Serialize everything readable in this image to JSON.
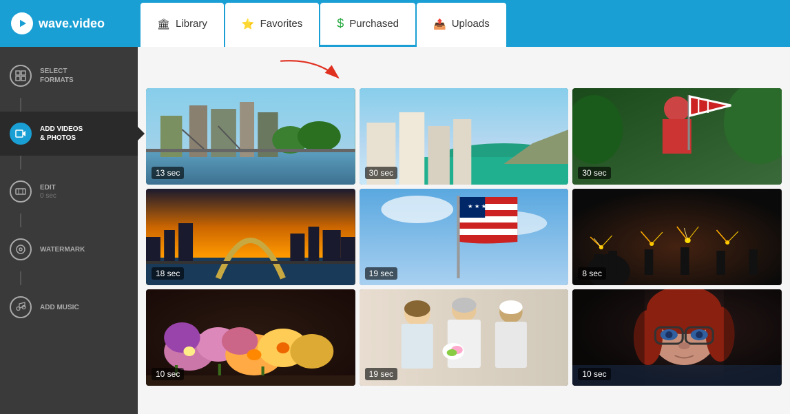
{
  "header": {
    "logo_text": "wave.video",
    "tabs": [
      {
        "id": "library",
        "label": "Library",
        "icon": "🏛",
        "active": false
      },
      {
        "id": "favorites",
        "label": "Favorites",
        "icon": "⭐",
        "active": false
      },
      {
        "id": "purchased",
        "label": "Purchased",
        "icon": "💲",
        "active": true
      },
      {
        "id": "uploads",
        "label": "Uploads",
        "icon": "📤",
        "active": false
      }
    ]
  },
  "sidebar": {
    "items": [
      {
        "id": "select-formats",
        "label": "SELECT\nFORMATS",
        "sub": "",
        "active": false,
        "icon": "⊞"
      },
      {
        "id": "add-videos",
        "label": "ADD VIDEOS\n& PHOTOS",
        "sub": "",
        "active": true,
        "icon": "🎬"
      },
      {
        "id": "edit",
        "label": "EDIT",
        "sub": "0 sec",
        "active": false,
        "icon": "✂"
      },
      {
        "id": "watermark",
        "label": "WATERMARK",
        "sub": "",
        "active": false,
        "icon": "◎"
      },
      {
        "id": "add-music",
        "label": "ADD MUSIC",
        "sub": "",
        "active": false,
        "icon": "♪"
      }
    ]
  },
  "videos": [
    {
      "id": 1,
      "duration": "13 sec",
      "thumb_class": "thumb-1",
      "alt": "City bridge aerial view"
    },
    {
      "id": 2,
      "duration": "30 sec",
      "thumb_class": "thumb-2",
      "alt": "Coastal city aerial"
    },
    {
      "id": 3,
      "duration": "30 sec",
      "thumb_class": "thumb-3",
      "alt": "Woman with American flag"
    },
    {
      "id": 4,
      "duration": "18 sec",
      "thumb_class": "thumb-4",
      "alt": "St Louis arch at sunset"
    },
    {
      "id": 5,
      "duration": "19 sec",
      "thumb_class": "thumb-5",
      "alt": "American flag waving"
    },
    {
      "id": 6,
      "duration": "8 sec",
      "thumb_class": "thumb-6",
      "alt": "Crowd with sparklers"
    },
    {
      "id": 7,
      "duration": "10 sec",
      "thumb_class": "thumb-7",
      "alt": "Colorful flowers arrangement"
    },
    {
      "id": 8,
      "duration": "19 sec",
      "thumb_class": "thumb-8",
      "alt": "People with flowers"
    },
    {
      "id": 9,
      "duration": "10 sec",
      "thumb_class": "thumb-9",
      "alt": "Woman with glasses working"
    }
  ],
  "arrow": {
    "visible": true
  }
}
